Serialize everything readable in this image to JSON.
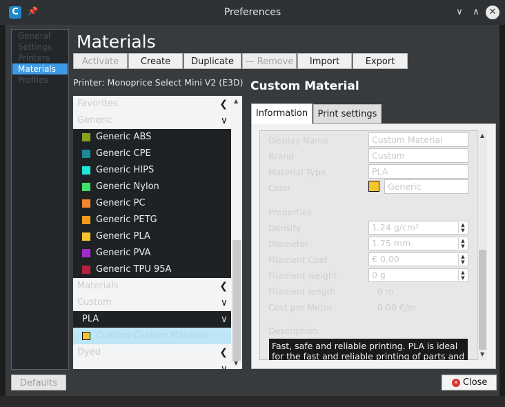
{
  "window": {
    "title": "Preferences",
    "app_icon": "C"
  },
  "categories": [
    "General",
    "Settings",
    "Printers",
    "Materials",
    "Profiles"
  ],
  "page_title": "Materials",
  "toolbar": [
    "Activate",
    "Create",
    "Duplicate",
    "— Remove",
    "Import",
    "Export"
  ],
  "printer_label": "Printer: Monoprice Select Mini V2 (E3D)",
  "material_list": {
    "brand_rows": [
      "Favorites",
      "Generic",
      "Materials",
      "Custom",
      "PLA",
      "Dyed"
    ],
    "generic_items": [
      {
        "name": "Generic ABS",
        "color": "#8aa31b"
      },
      {
        "name": "Generic CPE",
        "color": "#1b8a96"
      },
      {
        "name": "Generic HIPS",
        "color": "#1de8d8"
      },
      {
        "name": "Generic Nylon",
        "color": "#3fe06a"
      },
      {
        "name": "Generic PC",
        "color": "#f2872e"
      },
      {
        "name": "Generic PETG",
        "color": "#f29b1d"
      },
      {
        "name": "Generic PLA",
        "color": "#f7c52b"
      },
      {
        "name": "Generic PVA",
        "color": "#a02bd1"
      },
      {
        "name": "Generic TPU 95A",
        "color": "#b4213d"
      }
    ],
    "selected_item": {
      "name": "Custom Custom Material",
      "color": "#f7c52b"
    }
  },
  "detail": {
    "title": "Custom Material",
    "tabs": [
      "Information",
      "Print settings"
    ],
    "labels": [
      "Display Name",
      "Brand",
      "Material Type",
      "Color",
      "Properties",
      "Density",
      "Diameter",
      "Filament Cost",
      "Filament weight",
      "Filament length",
      "Cost per Meter",
      "Description"
    ],
    "values": {
      "display_name": "Custom Material",
      "brand": "Custom",
      "material_type": "PLA",
      "color_name": "Generic",
      "color_swatch": "#f7c52b",
      "density": "1.24 g/cm³",
      "diameter": "1.75 mm",
      "filament_cost": "€ 0.00",
      "filament_weight": "0 g",
      "filament_length": "0 m",
      "cost_per_meter": "0.00 €/m"
    },
    "description": "Fast, safe and reliable printing. PLA is ideal for the fast and reliable printing of parts and"
  },
  "footer": {
    "defaults": "Defaults",
    "close": "Close"
  }
}
